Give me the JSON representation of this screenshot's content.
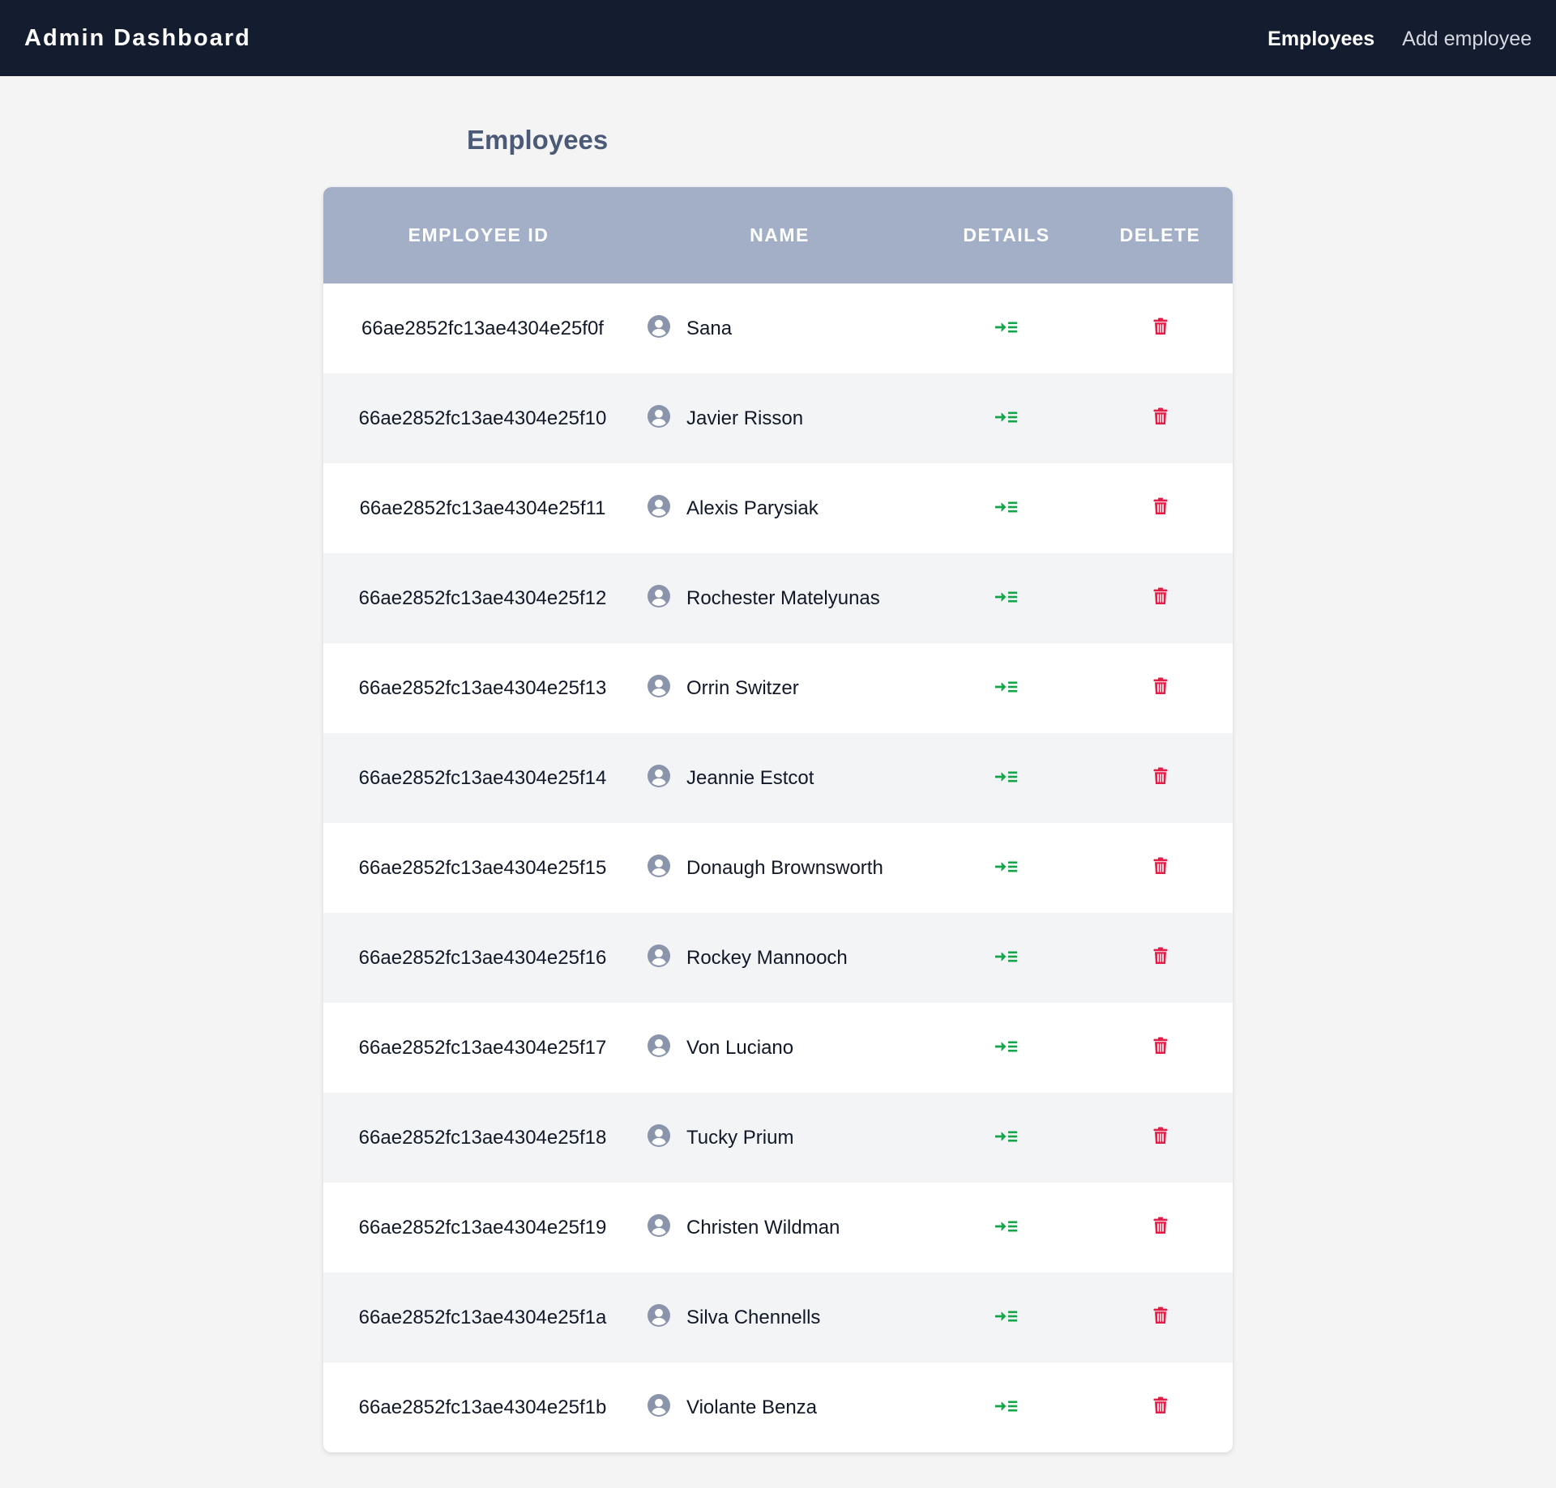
{
  "navbar": {
    "brand": "Admin Dashboard",
    "links": [
      {
        "label": "Employees",
        "active": true
      },
      {
        "label": "Add employee",
        "active": false
      }
    ]
  },
  "page": {
    "title": "Employees"
  },
  "table": {
    "headers": {
      "id": "EMPLOYEE ID",
      "name": "NAME",
      "details": "DETAILS",
      "delete": "DELETE"
    },
    "rows": [
      {
        "id": "66ae2852fc13ae4304e25f0f",
        "name": "Sana"
      },
      {
        "id": "66ae2852fc13ae4304e25f10",
        "name": "Javier Risson"
      },
      {
        "id": "66ae2852fc13ae4304e25f11",
        "name": "Alexis Parysiak"
      },
      {
        "id": "66ae2852fc13ae4304e25f12",
        "name": "Rochester Matelyunas"
      },
      {
        "id": "66ae2852fc13ae4304e25f13",
        "name": "Orrin Switzer"
      },
      {
        "id": "66ae2852fc13ae4304e25f14",
        "name": "Jeannie Estcot"
      },
      {
        "id": "66ae2852fc13ae4304e25f15",
        "name": "Donaugh Brownsworth"
      },
      {
        "id": "66ae2852fc13ae4304e25f16",
        "name": "Rockey Mannooch"
      },
      {
        "id": "66ae2852fc13ae4304e25f17",
        "name": "Von Luciano"
      },
      {
        "id": "66ae2852fc13ae4304e25f18",
        "name": "Tucky Prium"
      },
      {
        "id": "66ae2852fc13ae4304e25f19",
        "name": "Christen Wildman"
      },
      {
        "id": "66ae2852fc13ae4304e25f1a",
        "name": "Silva Chennells"
      },
      {
        "id": "66ae2852fc13ae4304e25f1b",
        "name": "Violante Benza"
      }
    ]
  },
  "icons": {
    "avatar": "user-circle-icon",
    "details": "arrow-right-list-icon",
    "delete": "trash-icon"
  },
  "colors": {
    "navbar_bg": "#141c2f",
    "header_bg": "#a3afc7",
    "details_green": "#16a34a",
    "delete_red": "#e11d48",
    "avatar_gray": "#8a94ab",
    "title_color": "#4b5a77"
  }
}
